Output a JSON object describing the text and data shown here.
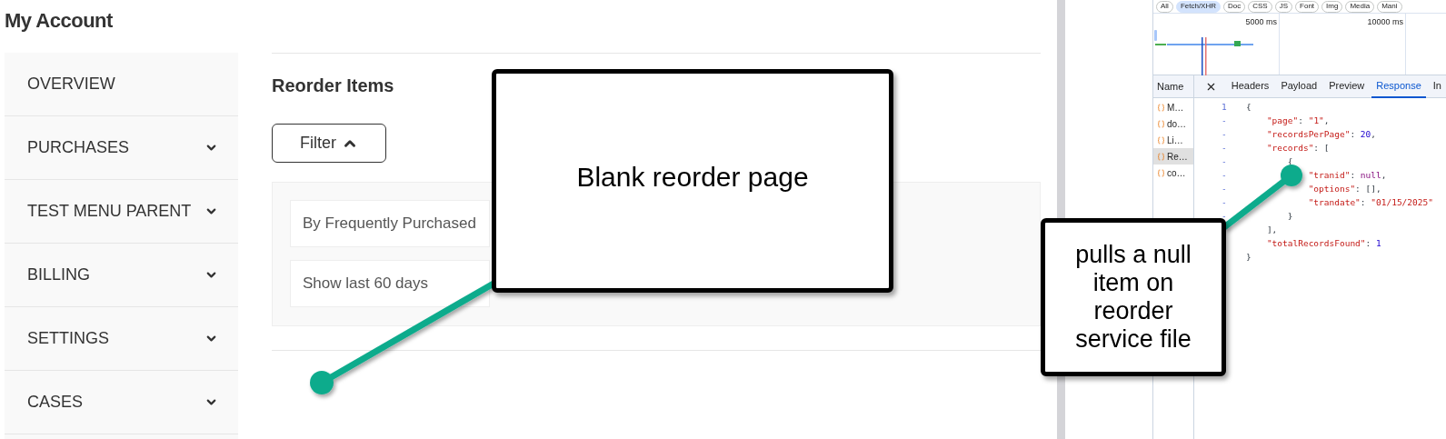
{
  "page_title": "My Account",
  "sidebar": {
    "items": [
      {
        "label": "OVERVIEW",
        "expandable": false
      },
      {
        "label": "PURCHASES",
        "expandable": true
      },
      {
        "label": "TEST MENU PARENT",
        "expandable": true
      },
      {
        "label": "BILLING",
        "expandable": true
      },
      {
        "label": "SETTINGS",
        "expandable": true
      },
      {
        "label": "CASES",
        "expandable": true
      }
    ]
  },
  "main": {
    "title": "Reorder Items",
    "filter_button": {
      "label": "Filter",
      "expanded": true
    },
    "filters": [
      {
        "value": "By Frequently Purchased"
      },
      {
        "value": "Show last 60 days"
      }
    ]
  },
  "devtools": {
    "filter_chips": [
      {
        "label": "All",
        "selected": false
      },
      {
        "label": "Fetch/XHR",
        "selected": true
      },
      {
        "label": "Doc",
        "selected": false
      },
      {
        "label": "CSS",
        "selected": false
      },
      {
        "label": "JS",
        "selected": false
      },
      {
        "label": "Font",
        "selected": false
      },
      {
        "label": "Img",
        "selected": false
      },
      {
        "label": "Media",
        "selected": false
      },
      {
        "label": "Mani",
        "selected": false
      }
    ],
    "timeline": {
      "ticks": [
        "5000 ms",
        "10000 ms"
      ]
    },
    "name_header": "Name",
    "tabs": [
      {
        "label": "Headers",
        "selected": false
      },
      {
        "label": "Payload",
        "selected": false
      },
      {
        "label": "Preview",
        "selected": false
      },
      {
        "label": "Response",
        "selected": true
      },
      {
        "label": "In",
        "selected": false
      }
    ],
    "requests": [
      {
        "name": "M…",
        "selected": false
      },
      {
        "name": "do…",
        "selected": false
      },
      {
        "name": "Li…",
        "selected": false
      },
      {
        "name": "Re…",
        "selected": true
      },
      {
        "name": "co…",
        "selected": false
      }
    ],
    "response_lines": [
      {
        "number": "1",
        "tokens": [
          {
            "kind": "punct",
            "text": "{"
          }
        ]
      },
      {
        "number": "-",
        "tokens": [
          {
            "kind": "key",
            "text": "    \"page\""
          },
          {
            "kind": "punct",
            "text": ": "
          },
          {
            "kind": "string",
            "text": "\"1\""
          },
          {
            "kind": "punct",
            "text": ","
          }
        ]
      },
      {
        "number": "-",
        "tokens": [
          {
            "kind": "key",
            "text": "    \"recordsPerPage\""
          },
          {
            "kind": "punct",
            "text": ": "
          },
          {
            "kind": "number",
            "text": "20"
          },
          {
            "kind": "punct",
            "text": ","
          }
        ]
      },
      {
        "number": "-",
        "tokens": [
          {
            "kind": "key",
            "text": "    \"records\""
          },
          {
            "kind": "punct",
            "text": ": ["
          }
        ]
      },
      {
        "number": "-",
        "tokens": [
          {
            "kind": "punct",
            "text": "        {"
          }
        ]
      },
      {
        "number": "-",
        "tokens": [
          {
            "kind": "key",
            "text": "            \"tranid\""
          },
          {
            "kind": "punct",
            "text": ": "
          },
          {
            "kind": "null",
            "text": "null"
          },
          {
            "kind": "punct",
            "text": ","
          }
        ]
      },
      {
        "number": "-",
        "tokens": [
          {
            "kind": "key",
            "text": "            \"options\""
          },
          {
            "kind": "punct",
            "text": ": [],"
          }
        ]
      },
      {
        "number": "-",
        "tokens": [
          {
            "kind": "key",
            "text": "            \"trandate\""
          },
          {
            "kind": "punct",
            "text": ": "
          },
          {
            "kind": "string",
            "text": "\"01/15/2025\""
          }
        ]
      },
      {
        "number": "-",
        "tokens": [
          {
            "kind": "punct",
            "text": "        }"
          }
        ]
      },
      {
        "tokens": [
          {
            "kind": "punct",
            "text": "    ],"
          }
        ]
      },
      {
        "tokens": [
          {
            "kind": "key",
            "text": "    \"totalRecordsFound\""
          },
          {
            "kind": "punct",
            "text": ": "
          },
          {
            "kind": "number",
            "text": "1"
          }
        ]
      },
      {
        "tokens": [
          {
            "kind": "punct",
            "text": "}"
          }
        ]
      }
    ]
  },
  "annotations": [
    {
      "text": "Blank reorder page"
    },
    {
      "text": "pulls a null item on reorder service file"
    }
  ]
}
